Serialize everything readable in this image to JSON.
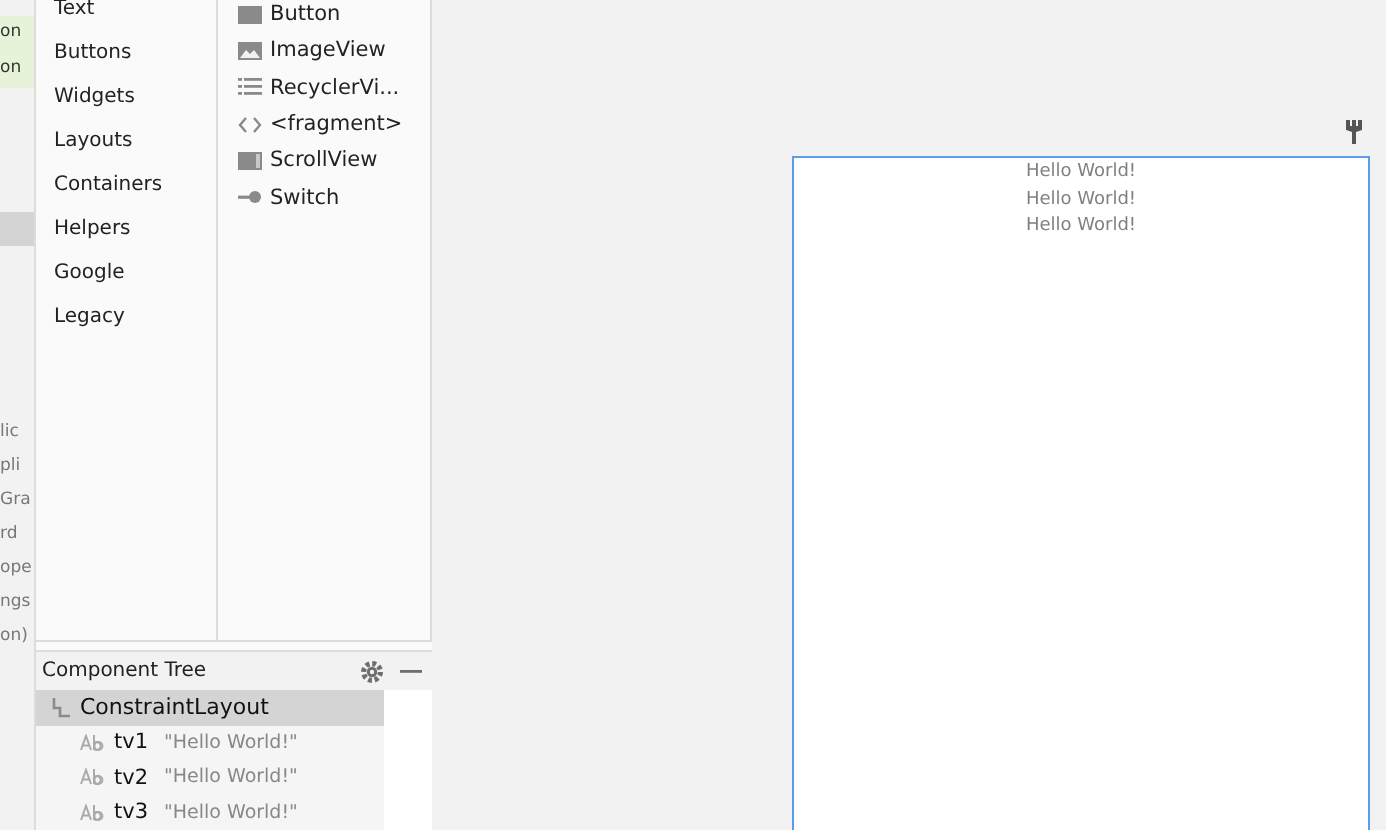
{
  "left_strip": [
    {
      "text": "on",
      "kind": "match",
      "selected": false
    },
    {
      "text": "on",
      "kind": "match",
      "selected": false
    },
    {
      "kind": "plain",
      "selected": true
    },
    {
      "text": "lic",
      "kind": "plain",
      "selected": false
    },
    {
      "text": "pli",
      "kind": "plain",
      "selected": false
    },
    {
      "text": "Gra",
      "kind": "plain",
      "selected": false
    },
    {
      "text": "rd",
      "kind": "plain",
      "selected": false
    },
    {
      "text": "ope",
      "kind": "plain",
      "selected": false
    },
    {
      "text": "ngs",
      "kind": "plain",
      "selected": false
    },
    {
      "text": "on)",
      "kind": "plain",
      "selected": false
    }
  ],
  "palette": {
    "categories": [
      {
        "label": "Text",
        "selected": false
      },
      {
        "label": "Buttons",
        "selected": false
      },
      {
        "label": "Widgets",
        "selected": false
      },
      {
        "label": "Layouts",
        "selected": false
      },
      {
        "label": "Containers",
        "selected": false
      },
      {
        "label": "Helpers",
        "selected": false
      },
      {
        "label": "Google",
        "selected": false
      },
      {
        "label": "Legacy",
        "selected": false
      }
    ],
    "items": [
      {
        "label": "Button",
        "kind": "block"
      },
      {
        "label": "ImageView",
        "kind": "image"
      },
      {
        "label": "RecyclerVi...",
        "kind": "list"
      },
      {
        "label": "<fragment>",
        "kind": "code"
      },
      {
        "label": "ScrollView",
        "kind": "scroll"
      },
      {
        "label": "Switch",
        "kind": "switch"
      }
    ]
  },
  "component_tree": {
    "title": "Component Tree",
    "items": [
      {
        "label": "ConstraintLayout",
        "kind": "layout",
        "selected": true,
        "children": [
          {
            "label": "tv1",
            "text": "\"Hello World!\"",
            "kind": "text",
            "selected": false
          },
          {
            "label": "tv2",
            "text": "\"Hello World!\"",
            "kind": "text",
            "selected": false
          },
          {
            "label": "tv3",
            "text": "\"Hello World!\"",
            "kind": "text",
            "selected": false
          }
        ]
      }
    ]
  },
  "design": {
    "texts": [
      "Hello World!",
      "Hello World!",
      "Hello World!"
    ]
  }
}
